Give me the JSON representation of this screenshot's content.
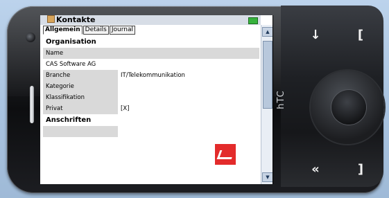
{
  "app": {
    "title": "Kontakte",
    "tabs": [
      {
        "label": "Allgemein",
        "active": true
      },
      {
        "label": "Details",
        "active": false
      },
      {
        "label": "Journal",
        "active": false
      }
    ]
  },
  "sections": {
    "organisation": "Organisation",
    "anschriften": "Anschriften"
  },
  "fields": {
    "name_label": "Name",
    "name_value": "CAS Software AG",
    "branche_label": "Branche",
    "branche_value": "IT/Telekommunikation",
    "kategorie_label": "Kategorie",
    "klassifikation_label": "Klassifikation",
    "privat_label": "Privat",
    "privat_value": "[X]"
  },
  "device": {
    "brand": "hTC"
  },
  "icons": {
    "title": "contacts-icon",
    "status": "network-status-icon",
    "logo": "cas-logo-icon",
    "up": "arrow-up-icon",
    "down": "arrow-down-icon"
  },
  "colors": {
    "title_bar": "#d7dde6",
    "row_gray": "#d9d9d9",
    "logo_red": "#e32b2b"
  }
}
